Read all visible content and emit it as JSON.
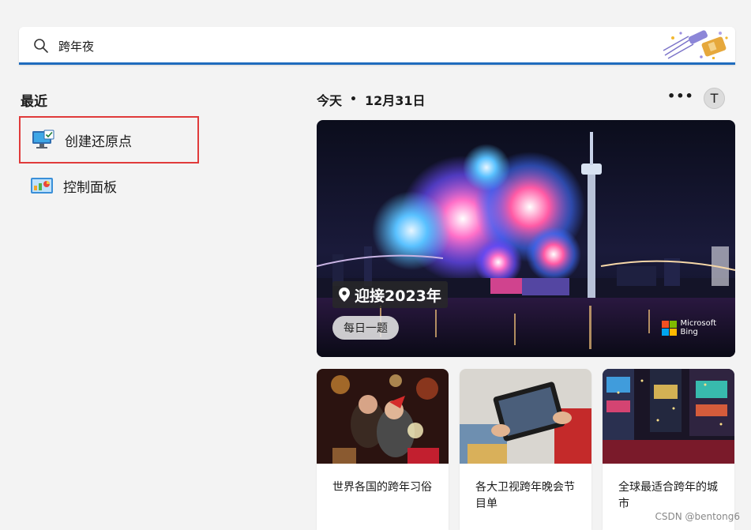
{
  "search": {
    "value": "跨年夜",
    "placeholder": ""
  },
  "recent": {
    "title": "最近",
    "items": [
      {
        "label": "创建还原点",
        "icon": "system-restore-icon"
      },
      {
        "label": "控制面板",
        "icon": "control-panel-icon"
      }
    ]
  },
  "today": {
    "label": "今天",
    "separator": "•",
    "date": "12月31日",
    "more": "•••",
    "avatar_letter": "T"
  },
  "hero": {
    "caption": "迎接2023年",
    "tag": "每日一题",
    "brand_line1": "Microsoft",
    "brand_line2": "Bing"
  },
  "cards": [
    {
      "title": "世界各国的跨年习俗"
    },
    {
      "title": "各大卫视跨年晚会节目单"
    },
    {
      "title": "全球最适合跨年的城市"
    }
  ],
  "watermark": "CSDN @bentong6",
  "colors": {
    "accent": "#1f6cbd",
    "selection_border": "#e03a3a",
    "ms_red": "#f25022",
    "ms_green": "#7fba00",
    "ms_blue": "#00a4ef",
    "ms_yellow": "#ffb900"
  }
}
